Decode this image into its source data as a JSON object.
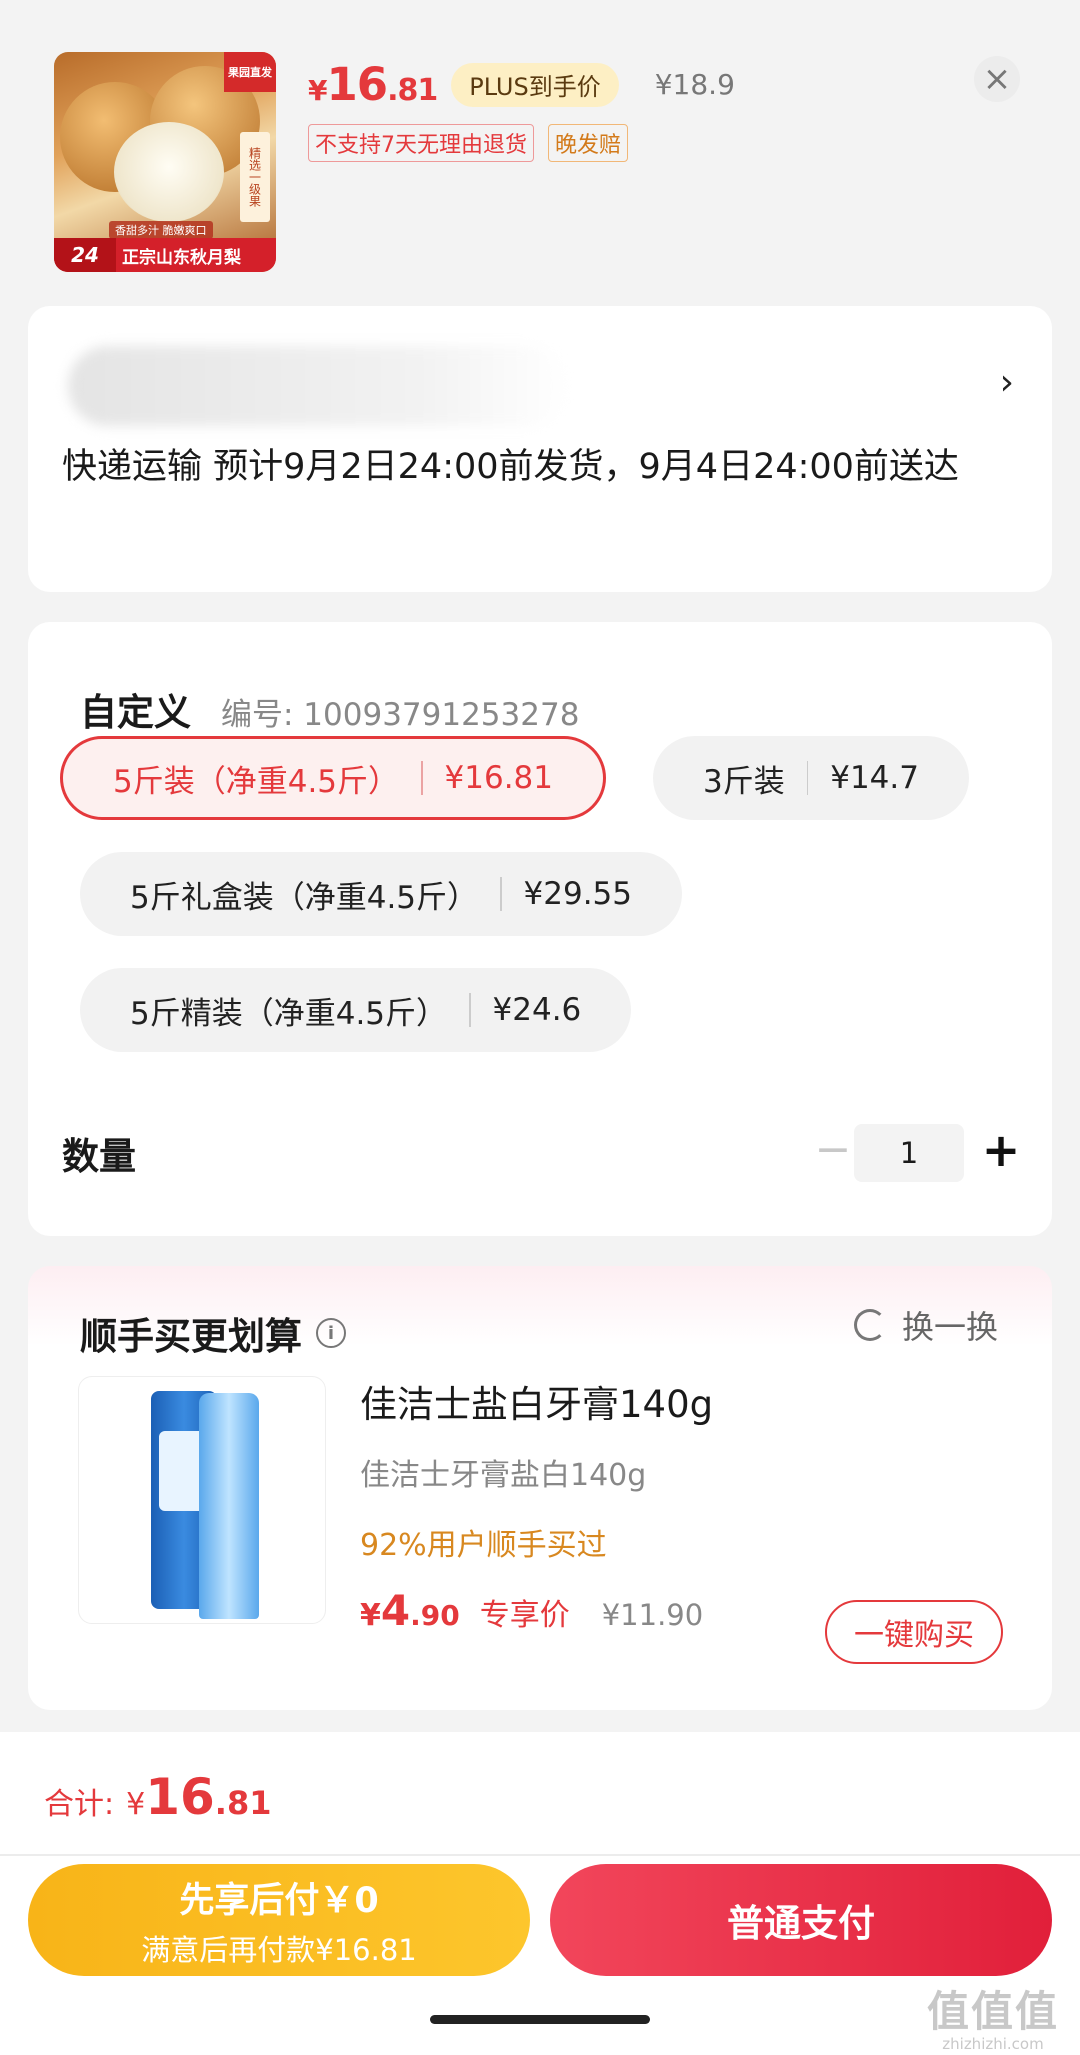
{
  "product": {
    "thumb": {
      "corner_badge": "果园直发",
      "side_tag": "精选一级果",
      "sub_caption": "香甜多汁 脆嫩爽口",
      "hours_badge": "24",
      "title": "正宗山东秋月梨"
    },
    "price": {
      "currency": "¥",
      "integer": "16",
      "decimal": ".81"
    },
    "plus_label": "PLUS到手价",
    "original_price": "¥18.9",
    "tags": [
      "不支持7天无理由退货",
      "晚发赔"
    ],
    "close_icon": "×"
  },
  "delivery": {
    "address_blurred": true,
    "arrow": "›",
    "shipping_text": "快递运输 预计9月2日24:00前发货，9月4日24:00前送达"
  },
  "spec": {
    "title": "自定义",
    "code": "编号: 10093791253278",
    "options": [
      {
        "label": "5斤装（净重4.5斤）",
        "price": "¥16.81",
        "selected": true
      },
      {
        "label": "3斤装",
        "price": "¥14.7",
        "selected": false
      },
      {
        "label": "5斤礼盒装（净重4.5斤）",
        "price": "¥29.55",
        "selected": false
      },
      {
        "label": "5斤精装（净重4.5斤）",
        "price": "¥24.6",
        "selected": false
      }
    ],
    "quantity_label": "数量",
    "quantity": "1",
    "minus": "−",
    "plus": "+"
  },
  "upsell": {
    "title": "顺手买更划算",
    "info_icon": "i",
    "swap_label": "换一换",
    "item": {
      "name": "佳洁士盐白牙膏140g",
      "subtitle": "佳洁士牙膏盐白140g",
      "popularity": "92%用户顺手买过",
      "price_currency": "¥",
      "price_integer": "4",
      "price_decimal": ".90",
      "exclusive_label": "专享价",
      "original_price": "¥11.90",
      "buy_button": "一键购买"
    }
  },
  "footer": {
    "total_label": "合计:",
    "total_currency": "¥",
    "total_integer": "16",
    "total_decimal": ".81",
    "pay_later_title": "先享后付￥0",
    "pay_later_sub": "满意后再付款¥16.81",
    "pay_normal": "普通支付",
    "watermark_big": "值值值",
    "watermark_small": "zhizhizhi.com"
  },
  "colors": {
    "accent_red": "#e4393c",
    "plus_gold": "#fdefc4",
    "pay_later_yellow": "#f8b418",
    "pay_red": "#e11f3a"
  }
}
